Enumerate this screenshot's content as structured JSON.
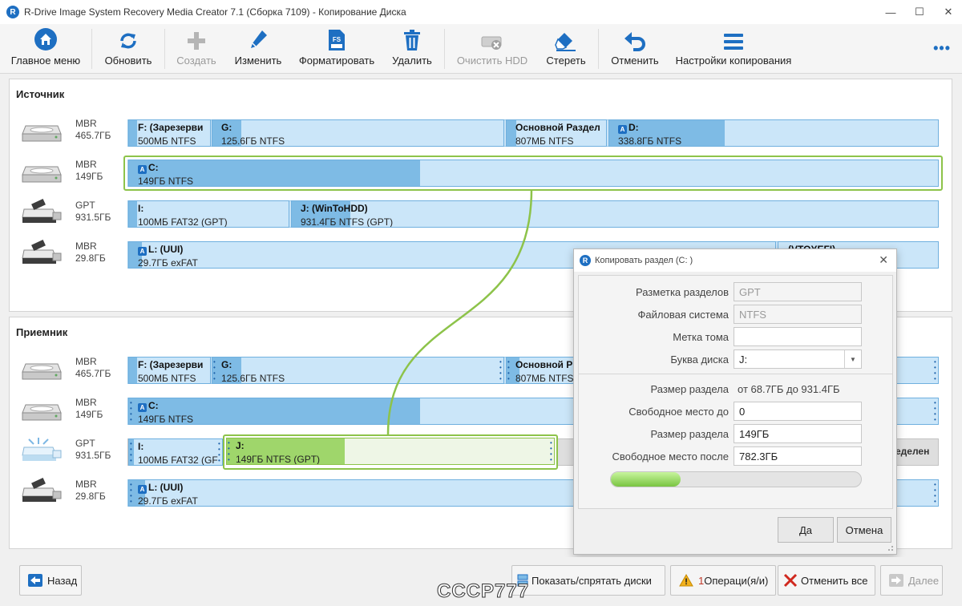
{
  "window": {
    "title": "R-Drive Image System Recovery Media Creator 7.1 (Сборка 7109) - Копирование Диска",
    "icon": "r-drive-logo-icon"
  },
  "toolbar": {
    "main_menu": "Главное меню",
    "refresh": "Обновить",
    "create": "Создать",
    "edit": "Изменить",
    "format": "Форматировать",
    "delete": "Удалить",
    "clear_hdd": "Очистить HDD",
    "erase": "Стереть",
    "undo": "Отменить",
    "copy_settings": "Настройки копирования",
    "more": "•••"
  },
  "source": {
    "title": "Источник",
    "disks": [
      {
        "type": "MBR",
        "size": "465.7ГБ",
        "icon": "hdd-icon",
        "parts": [
          {
            "name": "F: (Зарезерви",
            "info": "500МБ NTFS",
            "fill": 0.1
          },
          {
            "name": "G:",
            "info": "125.6ГБ NTFS",
            "fill": 0.1
          },
          {
            "name": "Основной Раздел",
            "info": "807МБ NTFS",
            "fill": 0.1
          },
          {
            "name": "D:",
            "info": "338.8ГБ NTFS",
            "fill": 0.35
          }
        ]
      },
      {
        "type": "MBR",
        "size": "149ГБ",
        "icon": "hdd-icon",
        "parts": [
          {
            "name": "C:",
            "info": "149ГБ NTFS",
            "fill": 0.36
          }
        ]
      },
      {
        "type": "GPT",
        "size": "931.5ГБ",
        "icon": "usb-drive-icon",
        "parts": [
          {
            "name": "I:",
            "info": "100МБ FAT32 (GPT)",
            "fill": 0.05
          },
          {
            "name": "J: (WinToHDD)",
            "info": "931.4ГБ NTFS (GPT)",
            "fill": 0.09
          }
        ]
      },
      {
        "type": "MBR",
        "size": "29.8ГБ",
        "icon": "usb-drive-icon",
        "parts": [
          {
            "name": "L: (UUI)",
            "info": "29.7ГБ exFAT",
            "fill": 0.02
          },
          {
            "name": "(VTOYEFI)",
            "info": "",
            "fill": 0.0
          }
        ]
      }
    ]
  },
  "target": {
    "title": "Приемник",
    "disks": [
      {
        "type": "MBR",
        "size": "465.7ГБ",
        "icon": "hdd-icon",
        "parts": [
          {
            "name": "F: (Зарезерви",
            "info": "500МБ NTFS",
            "fill": 0.1
          },
          {
            "name": "G:",
            "info": "125.6ГБ NTFS",
            "fill": 0.1
          },
          {
            "name": "Основной Р",
            "info": "807МБ NTFS",
            "fill": 0.1
          }
        ]
      },
      {
        "type": "MBR",
        "size": "149ГБ",
        "icon": "hdd-icon",
        "parts": [
          {
            "name": "C:",
            "info": "149ГБ NTFS",
            "fill": 0.36
          }
        ]
      },
      {
        "type": "GPT",
        "size": "931.5ГБ",
        "icon": "usb-drive-target-icon",
        "parts": [
          {
            "name": "I:",
            "info": "100МБ FAT32 (GF",
            "fill": 0.05
          },
          {
            "name": "J:",
            "info": "149ГБ NTFS (GPT)",
            "fill": 0.36
          },
          {
            "name": "еделен",
            "info": "",
            "fill": 0.0
          }
        ]
      },
      {
        "type": "MBR",
        "size": "29.8ГБ",
        "icon": "usb-drive-icon",
        "parts": [
          {
            "name": "L: (UUI)",
            "info": "29.7ГБ exFAT",
            "fill": 0.02
          }
        ]
      }
    ]
  },
  "dialog": {
    "title": "Копировать раздел (C: )",
    "close": "✕",
    "partition_scheme_label": "Разметка разделов",
    "partition_scheme_value": "GPT",
    "filesystem_label": "Файловая система",
    "filesystem_value": "NTFS",
    "volume_label_label": "Метка тома",
    "volume_label_value": "",
    "drive_letter_label": "Буква диска",
    "drive_letter_value": "J:",
    "partition_size_range_label": "Размер раздела",
    "partition_size_range_value": "от  68.7ГБ  до  931.4ГБ",
    "free_before_label": "Свободное место до",
    "free_before_value": "0",
    "partition_size_label": "Размер раздела",
    "partition_size_value": "149ГБ",
    "free_after_label": "Свободное место после",
    "free_after_value": "782.3ГБ",
    "size_fraction": 0.28,
    "ok": "Да",
    "cancel": "Отмена"
  },
  "bottom": {
    "back": "Назад",
    "show_hide": "Показать/спрятать диски",
    "ops_count": "1",
    "ops_label": " Операци(я/и)",
    "undo_all": "Отменить все",
    "next": "Далее"
  },
  "watermark": "CCCP777",
  "colors": {
    "accent": "#1e6fc2",
    "selection": "#8dc34a",
    "partition": "#cbe6f9",
    "used": "#7ebbe5",
    "target_used": "#9fd66b"
  }
}
